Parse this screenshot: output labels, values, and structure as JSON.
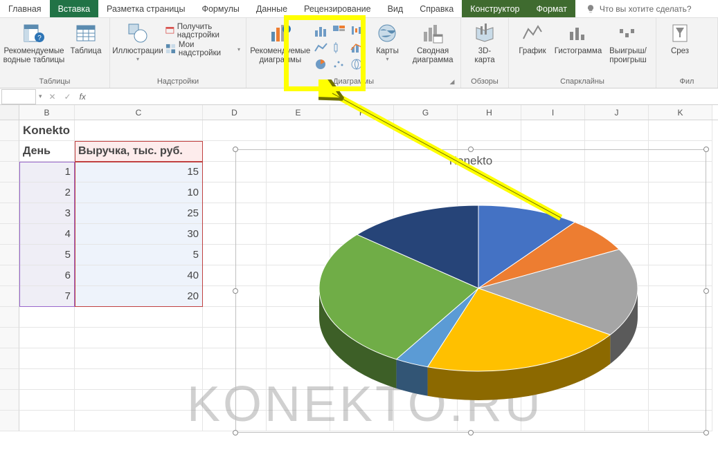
{
  "ribbon_tabs": {
    "home": "Главная",
    "insert": "Вставка",
    "layout": "Разметка страницы",
    "formulas": "Формулы",
    "data": "Данные",
    "review": "Рецензирование",
    "view": "Вид",
    "help": "Справка",
    "design": "Конструктор",
    "format": "Формат",
    "tellme": "Что вы хотите сделать?"
  },
  "ribbon_groups": {
    "tables": {
      "pivot": "Рекомендуемые водные таблицы",
      "table": "Таблица",
      "label": "Таблицы"
    },
    "illustrations": {
      "btn": "Иллюстрации",
      "label": "Надстройки",
      "get": "Получить надстройки",
      "my": "Мои надстройки"
    },
    "rec_charts": {
      "btn_l1": "Рекомендуемые",
      "btn_l2": "диаграммы"
    },
    "charts": {
      "maps": "Карты",
      "pivot": "Сводная",
      "pivot2": "диаграмма",
      "label": "Диаграммы"
    },
    "tours": {
      "btn_l1": "3D-",
      "btn_l2": "карта",
      "label": "Обзоры"
    },
    "sparklines": {
      "line": "График",
      "col": "Гистограмма",
      "wl_l1": "Выигрыш/",
      "wl_l2": "проигрыш",
      "label": "Спарклайны"
    },
    "filters": {
      "slicer": "Срез",
      "label": "Фил"
    }
  },
  "table": {
    "title": "Konekto",
    "day_hdr": "День",
    "rev_hdr": "Выручка, тыс. руб.",
    "rows": [
      {
        "d": "1",
        "v": "15"
      },
      {
        "d": "2",
        "v": "10"
      },
      {
        "d": "3",
        "v": "25"
      },
      {
        "d": "4",
        "v": "30"
      },
      {
        "d": "5",
        "v": "5"
      },
      {
        "d": "6",
        "v": "40"
      },
      {
        "d": "7",
        "v": "20"
      }
    ]
  },
  "columns": [
    "B",
    "C",
    "D",
    "E",
    "F",
    "G",
    "H",
    "I",
    "J",
    "K"
  ],
  "chart": {
    "title": "Konekto"
  },
  "chart_data": {
    "type": "pie",
    "title": "Konekto",
    "categories": [
      "1",
      "2",
      "3",
      "4",
      "5",
      "6",
      "7"
    ],
    "values": [
      15,
      10,
      25,
      30,
      5,
      40,
      20
    ],
    "series_name": "Выручка, тыс. руб.",
    "colors": [
      "#4472C4",
      "#ED7D31",
      "#A5A5A5",
      "#FFC000",
      "#5B9BD5",
      "#70AD47",
      "#264478"
    ]
  },
  "watermark": "KONEKTO.RU"
}
